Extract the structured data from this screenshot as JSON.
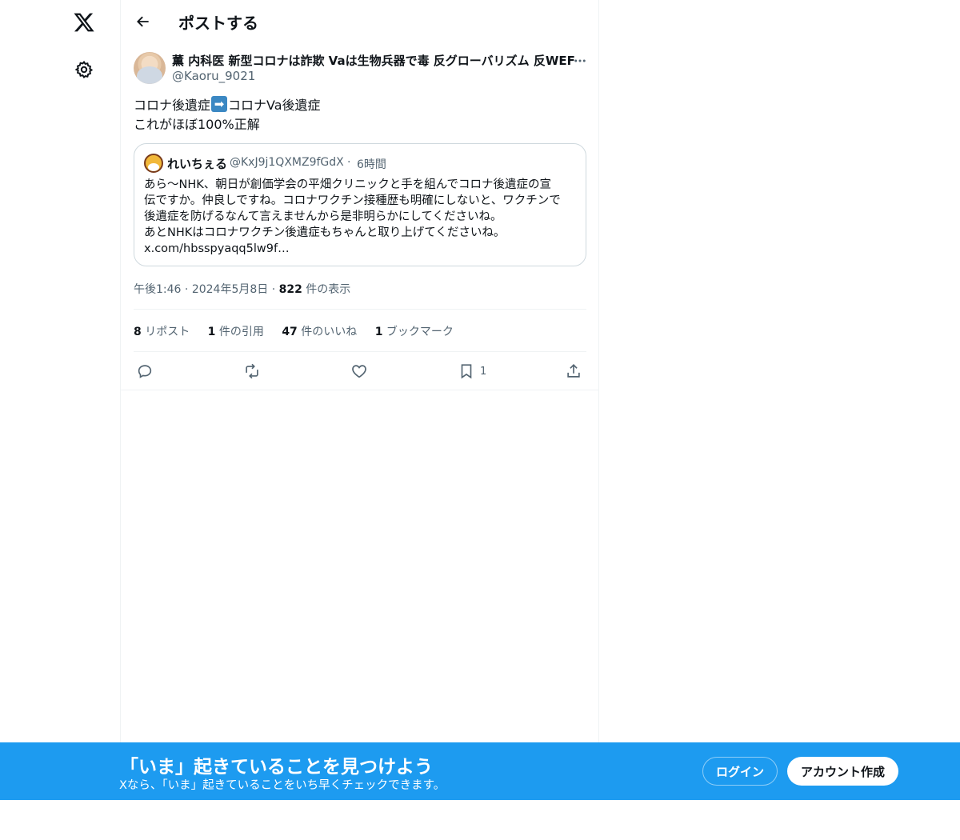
{
  "header": {
    "title": "ポストする"
  },
  "tweet": {
    "author_name": "薫 内科医 新型コロナは詐欺 Vaは生物兵器で毒 反グローバリズム 反WEF",
    "author_handle": "@Kaoru_9021",
    "text_line1_part1": "コロナ後遺症",
    "text_line1_part2": "コロナVa後遺症",
    "text_line2": "これがほぼ100%正解",
    "meta_time": "午後1:46",
    "meta_date": "2024年5月8日",
    "views_count": "822",
    "views_label": " 件の表示"
  },
  "quote": {
    "name": "れいちぇる",
    "handle": "@KxJ9j1QXMZ9fGdX",
    "time": "6時間",
    "lines": [
      "あら〜NHK、朝日が創価学会の平畑クリニックと手を組んでコロナ後遺症の宣",
      "伝ですか。仲良しですね。コロナワクチン接種歴も明確にしないと、ワクチンで",
      "後遺症を防げるなんて言えませんから是非明らかにしてくださいね。",
      "あとNHKはコロナワクチン後遺症もちゃんと取り上げてくださいね。",
      "x.com/hbsspyaqq5lw9f…"
    ]
  },
  "stats": {
    "reposts_count": "8",
    "reposts_label": " リポスト",
    "quotes_count": "1",
    "quotes_label": " 件の引用",
    "likes_count": "47",
    "likes_label": " 件のいいね",
    "bookmarks_count": "1",
    "bookmarks_label": " ブックマーク"
  },
  "actions": {
    "bookmark_count": "1"
  },
  "icons": {
    "logo": "x-logo-icon",
    "settings": "gear-icon",
    "back": "back-arrow-icon",
    "more": "more-icon",
    "reply": "reply-icon",
    "repost": "repost-icon",
    "like": "heart-icon",
    "bookmark": "bookmark-icon",
    "share": "share-icon"
  },
  "banner": {
    "title": "「いま」起きていることを見つけよう",
    "subtitle": "Xなら、「いま」起きていることをいち早くチェックできます。",
    "login_label": "ログイン",
    "signup_label": "アカウント作成"
  },
  "colors": {
    "accent": "#1d9bf0",
    "text": "#0f1419",
    "secondary": "#536471"
  }
}
